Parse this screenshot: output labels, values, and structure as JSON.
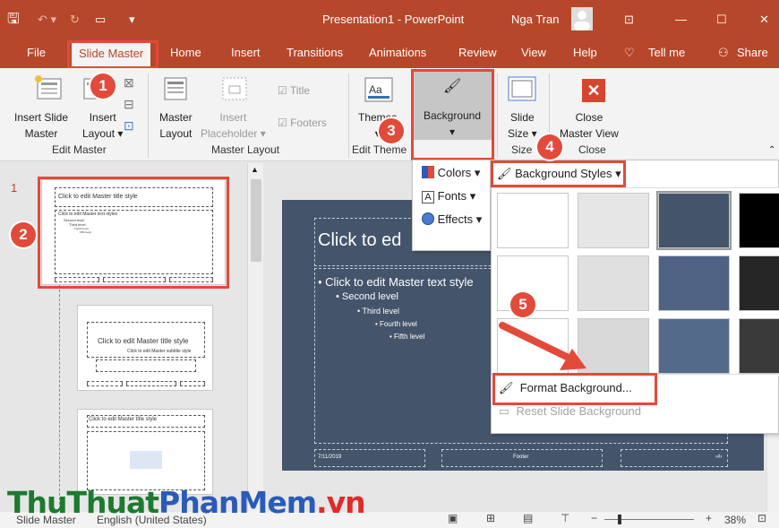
{
  "titlebar": {
    "document_title": "Presentation1 - PowerPoint",
    "user_name": "Nga Tran"
  },
  "tabs": [
    "File",
    "Slide Master",
    "Home",
    "Insert",
    "Transitions",
    "Animations",
    "Review",
    "View",
    "Help"
  ],
  "tell_me": "Tell me",
  "share": "Share",
  "ribbon": {
    "insert_slide_master": [
      "Insert Slide",
      "Master"
    ],
    "insert_layout": [
      "Insert",
      "Layout"
    ],
    "group_edit_master": "Edit Master",
    "master_layout": [
      "Master",
      "Layout"
    ],
    "insert_placeholder": [
      "Insert",
      "Placeholder"
    ],
    "title_check": "Title",
    "footers_check": "Footers",
    "group_master_layout": "Master Layout",
    "themes": "Themes",
    "group_edit_theme": "Edit Theme",
    "background": "Background",
    "slide_size": [
      "Slide",
      "Size"
    ],
    "group_size": "Size",
    "close_master_view": [
      "Close",
      "Master View"
    ],
    "group_close": "Close"
  },
  "theme_menu": {
    "colors": "Colors",
    "fonts": "Fonts",
    "effects": "Effects"
  },
  "background_styles": "Background Styles",
  "format_background": "Format Background...",
  "reset_slide_background": "Reset Slide Background",
  "swatch_colors": [
    "#ffffff",
    "#e7e6e6",
    "#44546a",
    "#000000",
    "#ffffff",
    "#e0e0e0",
    "#4e6284",
    "#262626",
    "#ffffff",
    "#d9d9d9",
    "#536a8a",
    "#3a3a3a"
  ],
  "thumbnails": {
    "slide_number": "1",
    "t1_title": "Click to edit Master title style",
    "t1_body": "Click to edit Master text styles",
    "t1_levels": [
      "Second level",
      "Third level",
      "Fourth level",
      "Fifth level"
    ],
    "t2_title": "Click to edit Master title style",
    "t2_sub": "Click to edit Master subtitle style",
    "t3_title": "Click to edit Master title style"
  },
  "slide": {
    "title": "Click to ed",
    "body": "Click to edit Master text style",
    "levels": [
      "Second level",
      "Third level",
      "Fourth level",
      "Fifth level"
    ],
    "date": "7/11/2019",
    "footer": "Footer",
    "page": "‹#›"
  },
  "badges": [
    "1",
    "2",
    "3",
    "4",
    "5"
  ],
  "status": {
    "view": "Slide Master",
    "language": "English (United States)",
    "zoom": "38%"
  },
  "watermark": {
    "part1": "Thu",
    "part2": "Thuat",
    "part3": "PhanMem",
    "part4": ".vn"
  },
  "colors": {
    "accent": "#b7472a",
    "highlight": "#e24a3a",
    "slide_bg": "#44546a"
  }
}
